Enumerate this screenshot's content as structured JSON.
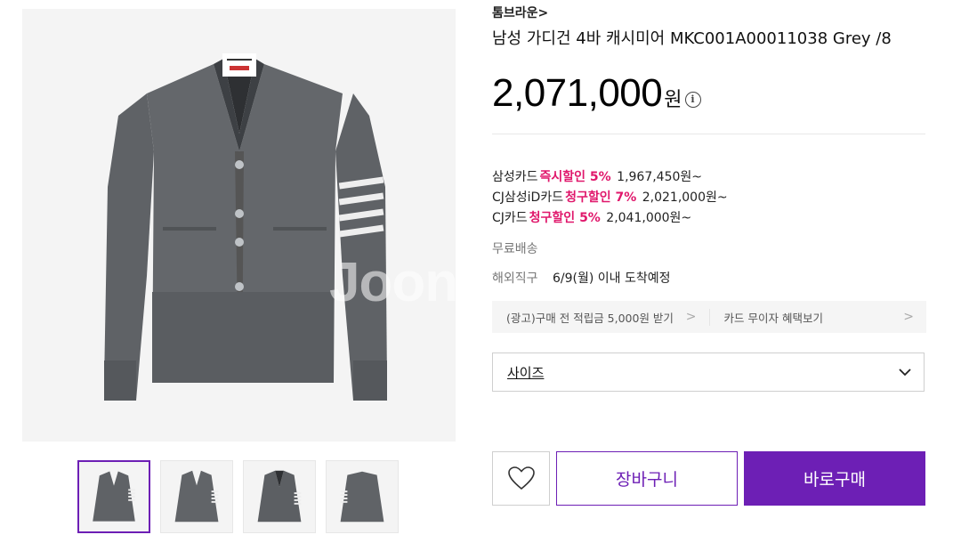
{
  "gallery": {
    "watermark": "Joong",
    "thumbnails": [
      "front",
      "front-alt",
      "front-open",
      "back"
    ]
  },
  "product": {
    "brand": "톰브라운>",
    "title": "남성 가디건 4바 캐시미어 MKC001A00011038 Grey /8",
    "price": "2,071,000",
    "currency": "원",
    "info_icon": "i"
  },
  "card_discounts": [
    {
      "card": "삼성카드",
      "type": "즉시할인 5%",
      "price": "1,967,450원~"
    },
    {
      "card": "CJ삼성iD카드",
      "type": "청구할인 7%",
      "price": "2,021,000원~"
    },
    {
      "card": "CJ카드",
      "type": "청구할인 5%",
      "price": "2,041,000원~"
    }
  ],
  "shipping": "무료배송",
  "overseas": {
    "label": "해외직구",
    "date": "6/9(월) 이내 도착예정"
  },
  "promos": [
    {
      "label": "(광고)구매 전 적립금 5,000원 받기",
      "arrow": ">"
    },
    {
      "label": "카드 무이자 혜택보기",
      "arrow": ">"
    }
  ],
  "option_select": {
    "label": "사이즈"
  },
  "actions": {
    "cart": "장바구니",
    "buy": "바로구매"
  },
  "colors": {
    "accent": "#6d1fb5",
    "discount": "#e0176b",
    "sweater": "#5f6266"
  }
}
